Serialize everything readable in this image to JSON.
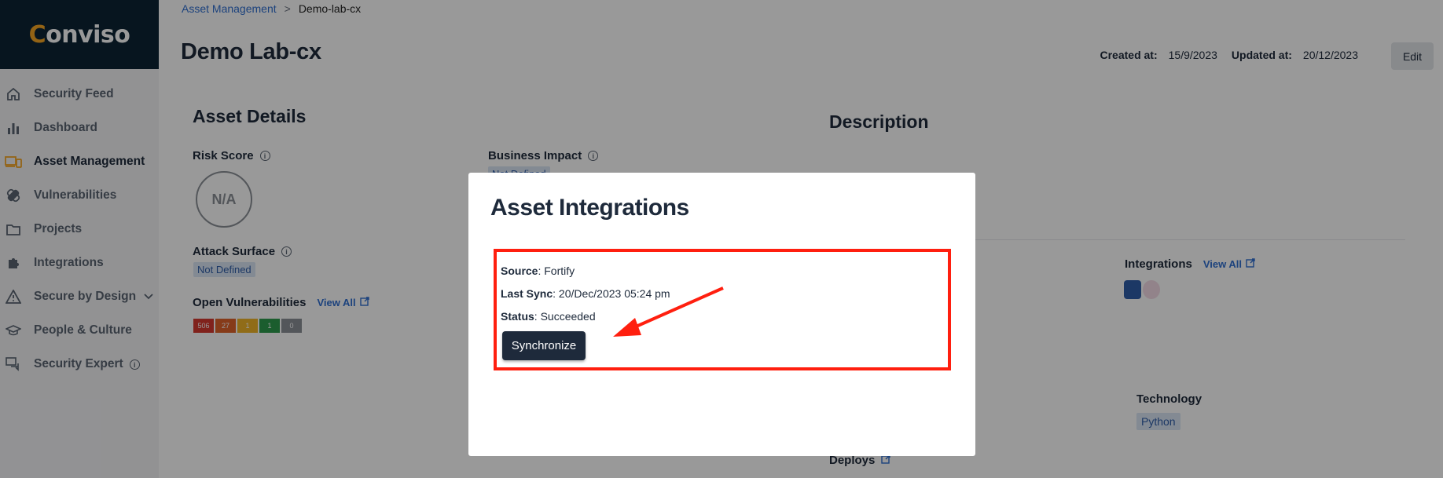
{
  "app": {
    "logo": "Conviso"
  },
  "sidebar": {
    "items": [
      {
        "label": "Security Feed",
        "icon": "home-icon"
      },
      {
        "label": "Dashboard",
        "icon": "bar-chart-icon"
      },
      {
        "label": "Asset Management",
        "icon": "devices-icon",
        "active": true
      },
      {
        "label": "Vulnerabilities",
        "icon": "bandage-icon"
      },
      {
        "label": "Projects",
        "icon": "folder-icon"
      },
      {
        "label": "Integrations",
        "icon": "puzzle-icon"
      },
      {
        "label": "Secure by Design",
        "icon": "warning-icon"
      },
      {
        "label": "People & Culture",
        "icon": "graduation-cap-icon"
      },
      {
        "label": "Security Expert",
        "icon": "chat-icon"
      }
    ]
  },
  "breadcrumb": {
    "parent": "Asset Management",
    "sep": ">",
    "current": "Demo-lab-cx"
  },
  "page": {
    "title": "Demo Lab-cx",
    "created_label": "Created at:",
    "created_value": "15/9/2023",
    "updated_label": "Updated at:",
    "updated_value": "20/12/2023",
    "edit_label": "Edit"
  },
  "asset_details": {
    "title": "Asset Details",
    "risk_score_label": "Risk Score",
    "risk_score_value": "N/A",
    "business_impact_label": "Business Impact",
    "business_impact_value": "Not Defined",
    "attack_surface_label": "Attack Surface",
    "attack_surface_value": "Not Defined",
    "open_vulns_label": "Open Vulnerabilities",
    "view_all": "View All",
    "vuln_counts": [
      {
        "value": "506",
        "color": "#d63a2f"
      },
      {
        "value": "27",
        "color": "#e0632a"
      },
      {
        "value": "1",
        "color": "#f0b429"
      },
      {
        "value": "1",
        "color": "#2d9b4e"
      },
      {
        "value": "0",
        "color": "#8a8f96"
      }
    ]
  },
  "description": {
    "title": "Description",
    "integrations_label": "Integrations",
    "view_all": "View All",
    "technology_label": "Technology",
    "technology_value": "Python",
    "deploys_label": "Deploys"
  },
  "modal": {
    "title": "Asset Integrations",
    "source_label": "Source",
    "source_value": ": Fortify",
    "last_sync_label": "Last Sync",
    "last_sync_value": ": 20/Dec/2023 05:24 pm",
    "status_label": "Status",
    "status_value": ": Succeeded",
    "button_label": "Synchronize"
  },
  "colors": {
    "accent": "#2f6fd1",
    "brand": "#0d2435",
    "logo_accent": "#f5a623",
    "highlight": "#ff1f0f",
    "button": "#1e2a3b"
  }
}
